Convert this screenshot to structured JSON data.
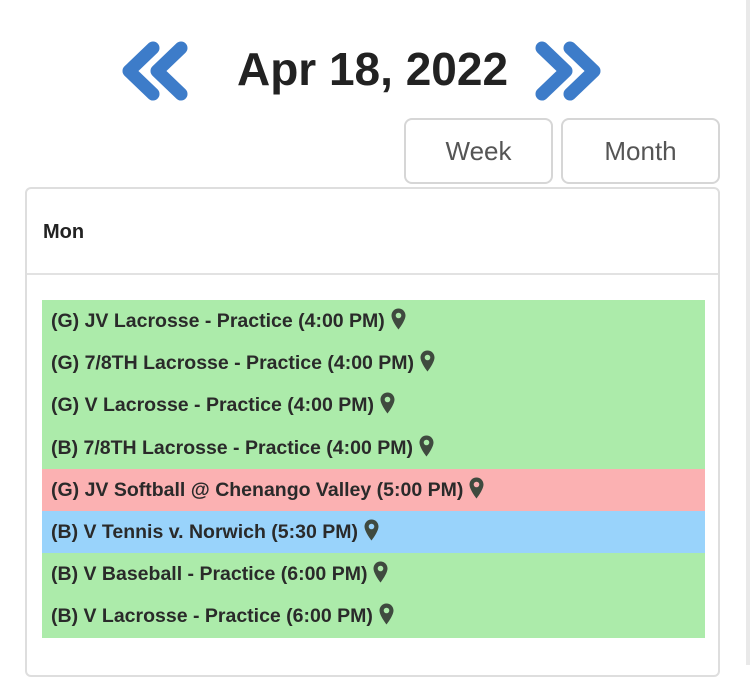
{
  "header": {
    "date": "Apr 18, 2022"
  },
  "views": {
    "week_label": "Week",
    "month_label": "Month"
  },
  "day": {
    "label": "Mon"
  },
  "colors": {
    "nav_arrow": "#3d7cc9",
    "practice": "#acebaa",
    "away": "#fbb1b2",
    "home": "#99d3fb",
    "pin": "#3f4a3f"
  },
  "events": [
    {
      "title": "(G) JV Lacrosse - Practice (4:00 PM)",
      "category": "practice",
      "icon": "map-pin-icon"
    },
    {
      "title": "(G) 7/8TH Lacrosse - Practice (4:00 PM)",
      "category": "practice",
      "icon": "map-pin-icon"
    },
    {
      "title": "(G) V Lacrosse - Practice (4:00 PM)",
      "category": "practice",
      "icon": "map-pin-icon"
    },
    {
      "title": "(B) 7/8TH Lacrosse - Practice (4:00 PM)",
      "category": "practice",
      "icon": "map-pin-icon"
    },
    {
      "title": "(G) JV Softball @ Chenango Valley (5:00 PM)",
      "category": "away",
      "icon": "map-pin-icon"
    },
    {
      "title": "(B) V Tennis v. Norwich (5:30 PM)",
      "category": "home",
      "icon": "map-pin-icon"
    },
    {
      "title": "(B) V Baseball - Practice (6:00 PM)",
      "category": "practice",
      "icon": "map-pin-icon"
    },
    {
      "title": "(B) V Lacrosse - Practice (6:00 PM)",
      "category": "practice",
      "icon": "map-pin-icon"
    }
  ]
}
